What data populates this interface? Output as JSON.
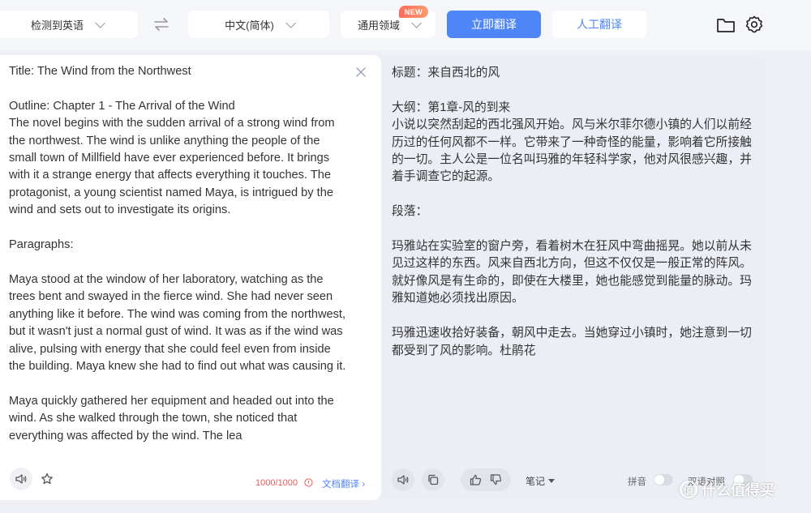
{
  "toolbar": {
    "source_lang": "检测到英语",
    "target_lang": "中文(简体)",
    "domain": "通用领域",
    "new_badge": "NEW",
    "translate_button": "立即翻译",
    "human_translate_button": "人工翻译"
  },
  "source": {
    "text": "Title: The Wind from the Northwest\n\nOutline: Chapter 1 - The Arrival of the Wind\nThe novel begins with the sudden arrival of a strong wind from the northwest. The wind is unlike anything the people of the small town of Millfield have ever experienced before. It brings with it a strange energy that affects everything it touches. The protagonist, a young scientist named Maya, is intrigued by the wind and sets out to investigate its origins.\n\nParagraphs:\n\nMaya stood at the window of her laboratory, watching as the trees bent and swayed in the fierce wind. She had never seen anything like it before. The wind was coming from the northwest, but it wasn't just a normal gust of wind. It was as if the wind was alive, pulsing with energy that she could feel even from inside the building. Maya knew she had to find out what was causing it.\n\nMaya quickly gathered her equipment and headed out into the wind. As she walked through the town, she noticed that everything was affected by the wind. The lea",
    "char_count": "1000/1000",
    "doc_translate_link": "文档翻译 ›"
  },
  "target": {
    "text": "标题：来自西北的风\n\n大纲：第1章-风的到来\n小说以突然刮起的西北强风开始。风与米尔菲尔德小镇的人们以前经历过的任何风都不一样。它带来了一种奇怪的能量，影响着它所接触的一切。主人公是一位名叫玛雅的年轻科学家，他对风很感兴趣，并着手调查它的起源。\n\n段落：\n\n玛雅站在实验室的窗户旁，看着树木在狂风中弯曲摇晃。她以前从未见过这样的东西。风来自西北方向，但这不仅仅是一般正常的阵风。就好像风是有生命的，即使在大楼里，她也能感觉到能量的脉动。玛雅知道她必须找出原因。\n\n玛雅迅速收拾好装备，朝风中走去。当她穿过小镇时，她注意到一切都受到了风的影响。杜鹃花",
    "notes_label": "笔记",
    "pinyin_label": "拼音",
    "bilingual_label": "双语对照"
  },
  "watermark": {
    "badge": "值",
    "text": "什么值得买"
  },
  "colors": {
    "accent": "#4f86f7",
    "warning": "#f05a5a",
    "new_badge": "#ff6d5a"
  }
}
